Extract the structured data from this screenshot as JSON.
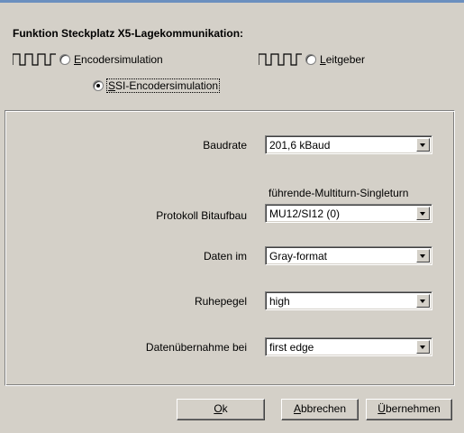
{
  "heading": "Funktion Steckplatz X5-Lagekommunikation:",
  "options": {
    "encoder_sim": {
      "accel": "E",
      "rest": "ncodersimulation",
      "checked": false
    },
    "leitgeber": {
      "accel": "L",
      "rest": "eitgeber",
      "checked": false
    },
    "ssi": {
      "accel": "S",
      "rest": "SI-Encodersimulation",
      "checked": true
    }
  },
  "fields": {
    "baudrate": {
      "label": "Baudrate",
      "value": "201,6 kBaud"
    },
    "protokoll": {
      "label": "Protokoll Bitaufbau",
      "hint": "führende-Multiturn-Singleturn",
      "value": "MU12/SI12 (0)"
    },
    "daten": {
      "label": "Daten im",
      "value": "Gray-format"
    },
    "ruhepegel": {
      "label": "Ruhepegel",
      "value": "high"
    },
    "uebernahme": {
      "label": "Datenübernahme bei",
      "value": "first edge"
    }
  },
  "buttons": {
    "ok": {
      "accel": "O",
      "rest": "k"
    },
    "cancel": {
      "accel": "A",
      "rest": "bbrechen"
    },
    "apply": {
      "accel": "Ü",
      "rest": "bernehmen"
    }
  },
  "colors": {
    "dialog_bg": "#d4d0c8",
    "title_accent": "#6b8fbf"
  },
  "icons": [
    "pulse-waveform-icon",
    "radio-button-icon",
    "dropdown-arrow-icon"
  ]
}
